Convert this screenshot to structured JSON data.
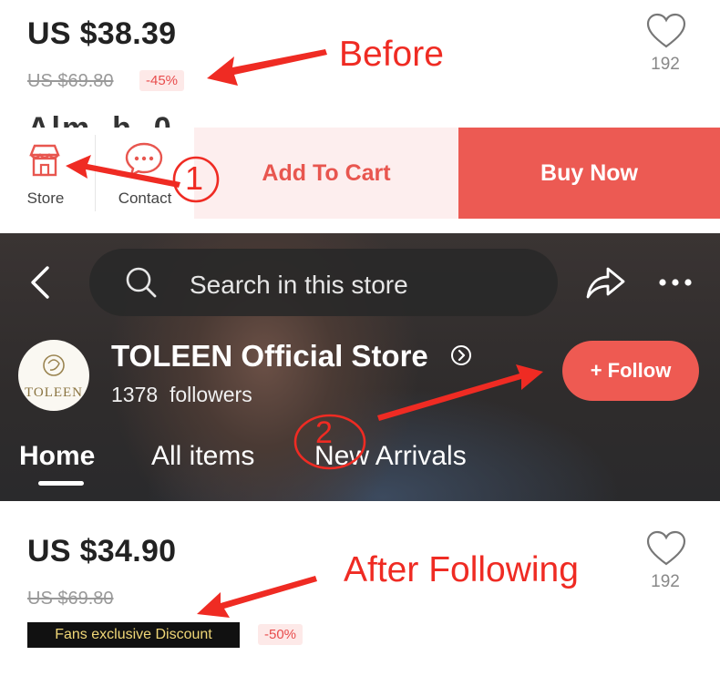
{
  "before_panel": {
    "price": "US $38.39",
    "original_price": "US $69.80",
    "discount": "-45%",
    "favorite_count": "192"
  },
  "annotations": {
    "before": "Before",
    "after": "After Following",
    "step1": "1",
    "step2": "2"
  },
  "action_bar": {
    "store_label": "Store",
    "contact_label": "Contact",
    "add_to_cart": "Add To Cart",
    "buy_now": "Buy Now"
  },
  "store_header": {
    "search_placeholder": "Search in this store",
    "store_name": "TOLEEN Official Store",
    "followers_count": "1378",
    "followers_label": "followers",
    "follow_button": "+ Follow",
    "avatar_text": "TOLEEN",
    "tabs": [
      "Home",
      "All items",
      "New Arrivals"
    ],
    "active_tab": "Home"
  },
  "after_panel": {
    "price": "US $34.90",
    "original_price": "US $69.80",
    "fans_badge": "Fans exclusive Discount",
    "discount": "-50%",
    "favorite_count": "192"
  },
  "colors": {
    "accent_red": "#ec5a53",
    "annotation_red": "#ef2b23",
    "badge_gold": "#f0d777"
  }
}
